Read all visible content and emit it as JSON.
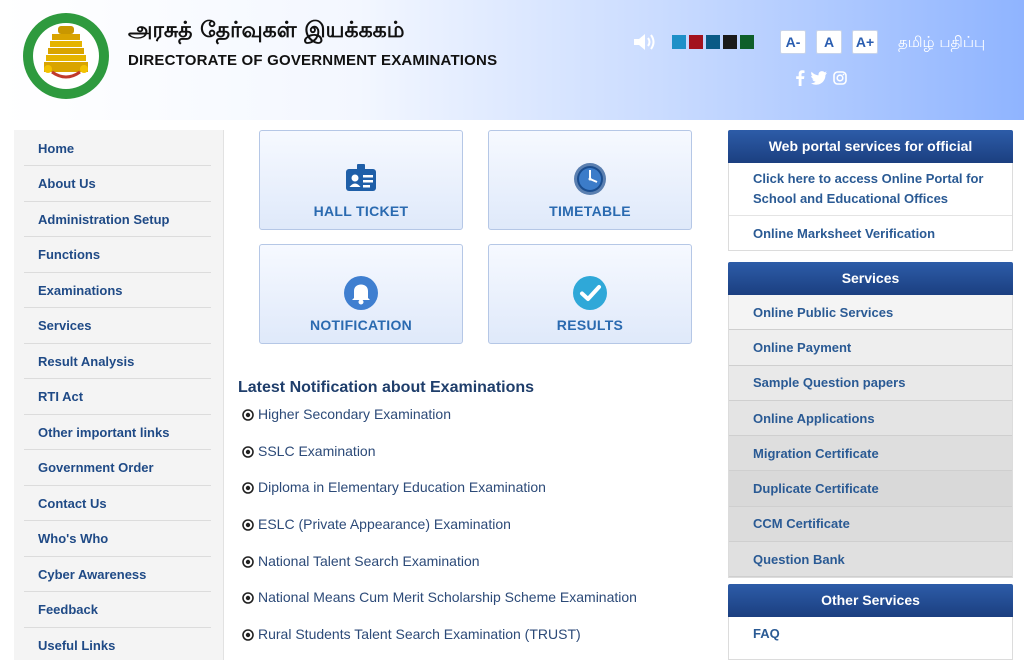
{
  "header": {
    "title_tamil": "அரசுத் தேர்வுகள் இயக்ககம்",
    "title_english": "DIRECTORATE OF GOVERNMENT EXAMINATIONS",
    "font_minus": "A-",
    "font_normal": "A",
    "font_plus": "A+",
    "language_link": "தமிழ் பதிப்பு",
    "theme_colors": [
      "#1e90c8",
      "#a3121e",
      "#0a5a86",
      "#1a1a1a",
      "#0f5f2a"
    ]
  },
  "sidebar": {
    "items": [
      "Home",
      "About Us",
      "Administration Setup",
      "Functions",
      "Examinations",
      "Services",
      "Result Analysis",
      "RTI Act",
      "Other important links",
      "Government Order",
      "Contact Us",
      "Who's Who",
      "Cyber Awareness",
      "Feedback",
      "Useful Links"
    ]
  },
  "tiles": {
    "hall_ticket": "HALL TICKET",
    "timetable": "TIMETABLE",
    "notification": "NOTIFICATION",
    "results": "RESULTS"
  },
  "notifications": {
    "title": "Latest Notification about Examinations",
    "items": [
      "Higher Secondary Examination",
      "SSLC Examination",
      "Diploma in Elementary Education Examination",
      "ESLC (Private Appearance) Examination",
      "National Talent Search Examination",
      "National Means Cum Merit Scholarship Scheme Examination",
      "Rural Students Talent Search Examination (TRUST)"
    ]
  },
  "web_portal": {
    "title": "Web portal services for official",
    "links": [
      "Click here to access Online Portal for School and Educational Offices",
      "Online Marksheet Verification"
    ]
  },
  "services": {
    "title": "Services",
    "items": [
      "Online Public Services",
      "Online Payment",
      "Sample Question papers",
      "Online Applications",
      "Migration Certificate",
      "Duplicate Certificate",
      "CCM Certificate",
      "Question Bank"
    ]
  },
  "other_services": {
    "title": "Other Services",
    "items": [
      "FAQ"
    ]
  },
  "colors": {
    "accent_blue": "#1b3f80",
    "link_blue": "#2a5a94",
    "tile_label": "#2a6ab0"
  }
}
